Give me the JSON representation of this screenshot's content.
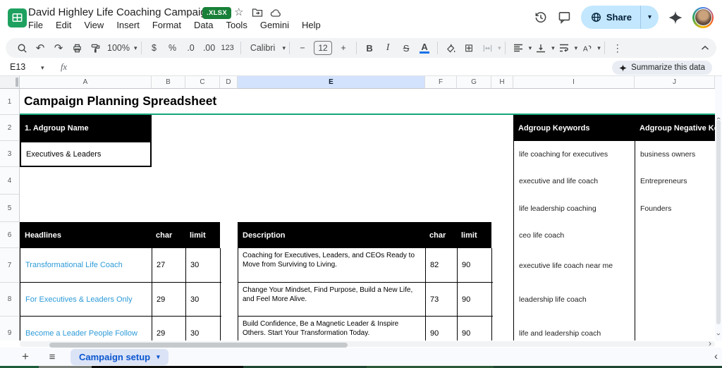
{
  "titlebar": {
    "title": "David Highley Life Coaching Campaign",
    "file_badge": ".XLSX",
    "menu_items": [
      "File",
      "Edit",
      "View",
      "Insert",
      "Format",
      "Data",
      "Tools",
      "Gemini",
      "Help"
    ],
    "share_label": "Share"
  },
  "toolbar": {
    "zoom_value": "100%",
    "currency": "$",
    "percent": "%",
    "decimal_decrease": ".0",
    "decimal_increase": ".00",
    "number_format": "123",
    "font_name": "Calibri",
    "font_size": "12",
    "bold": "B",
    "italic": "I",
    "strikethrough": "S",
    "text_color": "A"
  },
  "formula_bar": {
    "cell_reference": "E13",
    "fx_label": "fx",
    "summarize_label": "Summarize this data"
  },
  "sheet": {
    "column_headers": [
      "A",
      "B",
      "C",
      "D",
      "E",
      "F",
      "G",
      "H",
      "I",
      "J"
    ],
    "selected_column": "E",
    "row_headers": [
      "1",
      "2",
      "3",
      "4",
      "5",
      "6",
      "7",
      "8",
      "9"
    ],
    "title": "Campaign Planning Spreadsheet",
    "adgroup_name_header": "1. Adgroup Name",
    "adgroup_name_value": "Executives & Leaders",
    "headlines_table": {
      "col1": "Headlines",
      "col2": "char",
      "col3": "limit",
      "rows": [
        {
          "text": "Transformational Life Coach",
          "char": "27",
          "limit": "30"
        },
        {
          "text": "For Executives & Leaders Only",
          "char": "29",
          "limit": "30"
        },
        {
          "text": "Become a Leader People Follow",
          "char": "29",
          "limit": "30"
        }
      ]
    },
    "description_table": {
      "col1": "Description",
      "col2": "char",
      "col3": "limit",
      "rows": [
        {
          "text": "Coaching for Executives, Leaders, and CEOs Ready to Move from Surviving to Living.",
          "char": "82",
          "limit": "90"
        },
        {
          "text": "Change Your Mindset, Find Purpose, Build a New Life, and Feel More Alive.",
          "char": "73",
          "limit": "90"
        },
        {
          "text": "Build Confidence, Be a Magnetic Leader & Inspire Others. Start Your Transformation Today.",
          "char": "90",
          "limit": "90"
        }
      ]
    },
    "keywords_table": {
      "col1": "Adgroup Keywords",
      "col2": "Adgroup Negative Keywords",
      "keywords": [
        "life coaching for executives",
        "executive and life coach",
        "life leadership coaching",
        "ceo life coach",
        "executive life coach near me",
        "leadership life coach",
        "life and leadership coach"
      ],
      "negative_keywords": [
        "business owners",
        "Entrepreneurs",
        "Founders"
      ]
    }
  },
  "bottom_bar": {
    "sheet_tab": "Campaign setup"
  },
  "icons": {
    "caret_down": "▾",
    "vertical_ellipsis": "⋮",
    "star_outline": "☆",
    "chevron_left": "‹",
    "chevron_right": "›",
    "chevron_up": "‹",
    "plus": "+",
    "hamburger": "≡",
    "grid_borders": "⊞",
    "undo": "↶",
    "redo": "↷",
    "minus": "−",
    "collapse_caret": "^"
  },
  "colors": {
    "accent_green": "#17a57b",
    "table_header_bg": "#000000",
    "link_blue": "#2e9bd8",
    "share_bg": "#c2e7ff",
    "share_text": "#001d35",
    "tab_blue": "#0b57d0",
    "tab_bg": "#dbe3f6",
    "selected_col_bg": "#d3e3fd",
    "badge_green": "#188038",
    "logo_green": "#1ea15f",
    "toolbar_bg": "#f1f3f4"
  }
}
